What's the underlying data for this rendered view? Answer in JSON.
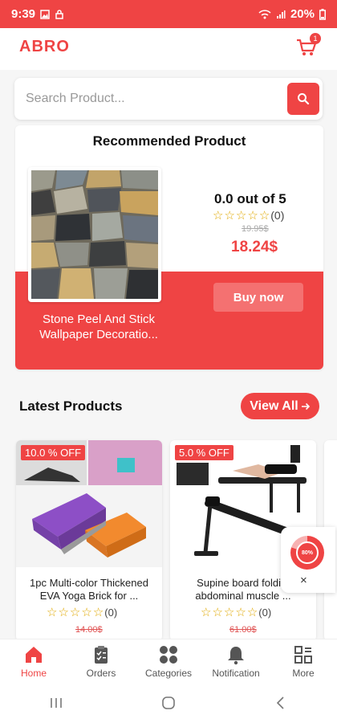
{
  "status_bar": {
    "time": "9:39",
    "battery": "20%"
  },
  "header": {
    "logo": "ABRO",
    "cart_count": "1"
  },
  "search": {
    "placeholder": "Search Product..."
  },
  "recommended": {
    "title": "Recommended Product",
    "rating_text": "0.0 out of 5",
    "review_count": "(0)",
    "old_price": "19.95$",
    "price": "18.24$",
    "buy_label": "Buy now",
    "product_name": "Stone Peel And Stick Wallpaper Decoratio..."
  },
  "latest": {
    "title": "Latest Products",
    "view_all_label": "View All",
    "products": [
      {
        "badge": "10.0 % OFF",
        "name": "1pc Multi-color Thickened EVA Yoga Brick for ...",
        "reviews": "(0)",
        "old_price": "14.00$"
      },
      {
        "badge": "5.0 % OFF",
        "name": "Supine board foldi... abdominal muscle ...",
        "reviews": "(0)",
        "old_price": "61.00$"
      }
    ]
  },
  "float_widget": {
    "percent": "80%",
    "close": "×"
  },
  "bottom_nav": {
    "items": [
      {
        "label": "Home"
      },
      {
        "label": "Orders"
      },
      {
        "label": "Categories"
      },
      {
        "label": "Notification"
      },
      {
        "label": "More"
      }
    ]
  },
  "colors": {
    "accent": "#ef4444",
    "star": "#e0a800"
  }
}
